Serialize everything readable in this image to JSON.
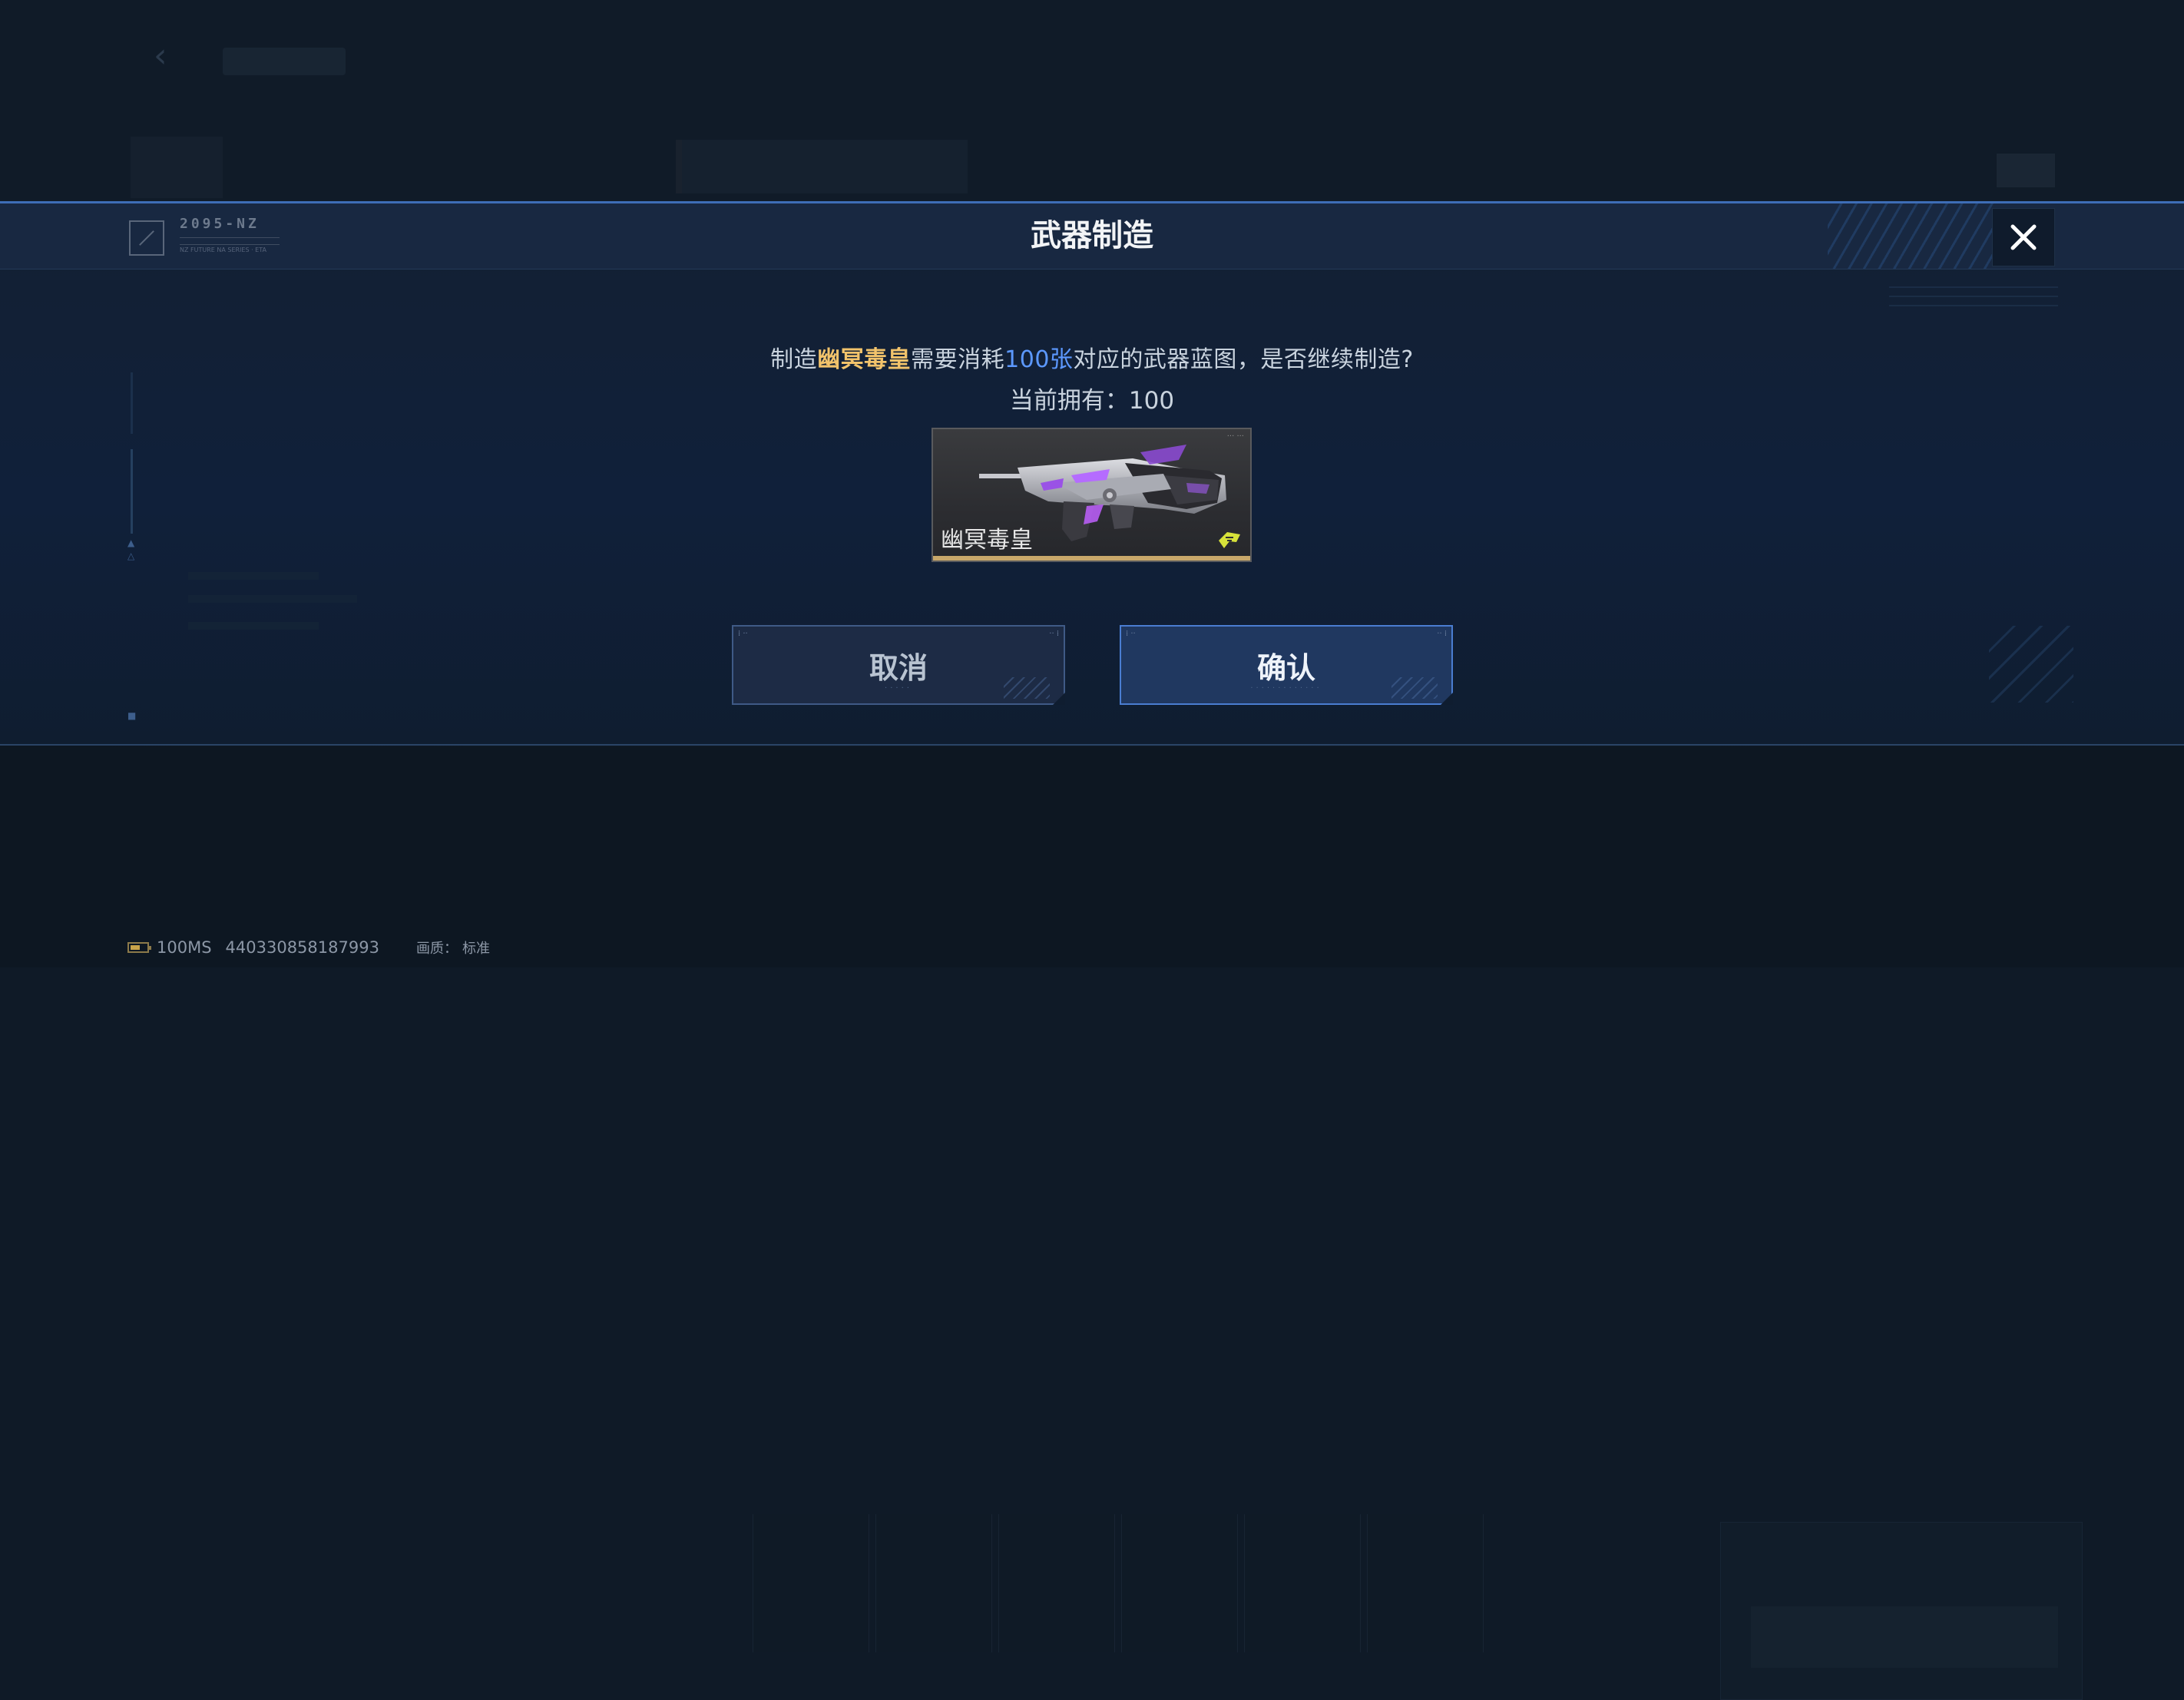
{
  "dialog": {
    "title": "武器制造",
    "logo_text": "2095-NZ",
    "logo_sub": "NZ FUTURE NA SERIES · ETA",
    "message": {
      "prefix": "制造",
      "weapon_name": "幽冥毒皇",
      "middle": "需要消耗",
      "count": "100张",
      "suffix": "对应的武器蓝图，是否继续制造?"
    },
    "owned_label": "当前拥有：",
    "owned_value": "100",
    "weapon_card": {
      "name": "幽冥毒皇",
      "rarity_color": "#c9a86a"
    },
    "cancel_label": "取消",
    "confirm_label": "确认"
  },
  "status_bar": {
    "ping": "100MS",
    "uid": "440330858187993",
    "quality_label": "画质：",
    "quality_value": "标准"
  },
  "colors": {
    "accent_blue": "#4a7dd1",
    "weapon_highlight": "#f2c36b",
    "count_highlight": "#5c98ff"
  }
}
